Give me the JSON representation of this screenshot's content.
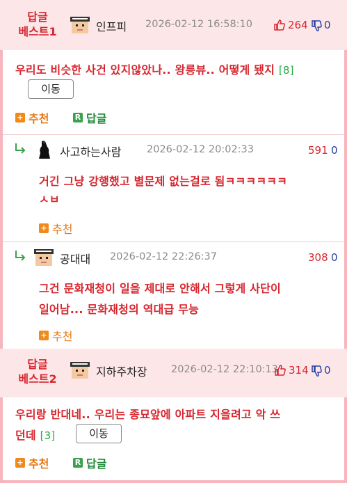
{
  "colors": {
    "accent_red": "#d7262e",
    "best_bg": "#fde6e8",
    "border_pink": "#f7b6bd",
    "recommend_orange": "#e67817",
    "reply_green": "#1f8a3a",
    "down_blue": "#2340a6"
  },
  "comments": [
    {
      "best_label_1": "답글",
      "best_label_2": "베스트1",
      "nickname": "인프피",
      "date": "2026-02-12 16:58:10",
      "upvotes": "264",
      "downvotes": "0",
      "text": "우리도 비슷한 사건 있지않았나.. 왕릉뷰.. 어떻게 됐지",
      "reply_count": "[8]",
      "move_label": "이동",
      "recommend_label": "추천",
      "reply_label": "답글"
    },
    {
      "nickname": "사고하는사람",
      "date": "2026-02-12 20:02:33",
      "upvotes": "591",
      "downvotes": "0",
      "text": "거긴 그냥 강행했고 별문제 없는걸로 됨ㅋㅋㅋㅋㅋㅋ",
      "text_cut": "ㅅㅂ",
      "recommend_label": "추천"
    },
    {
      "nickname": "공대대",
      "date": "2026-02-12 22:26:37",
      "upvotes": "308",
      "downvotes": "0",
      "text_line1": "그건 문화재청이 일을 제대로 안해서 그렇게 사단이",
      "text_line2": "일어남... 문화재청의 역대급 무능",
      "recommend_label": "추천"
    },
    {
      "best_label_1": "답글",
      "best_label_2": "베스트2",
      "nickname": "지하주차장",
      "date": "2026-02-12 22:10:13",
      "upvotes": "314",
      "downvotes": "0",
      "text_line1": "우리랑 반대네.. 우리는 종묘앞에 아파트 지을려고 악 쓰",
      "text_line2": "던데",
      "reply_count": "[3]",
      "move_label": "이동",
      "recommend_label": "추천",
      "reply_label": "답글"
    }
  ],
  "icons": {
    "reply_box": "R",
    "recommend_box": "+"
  }
}
